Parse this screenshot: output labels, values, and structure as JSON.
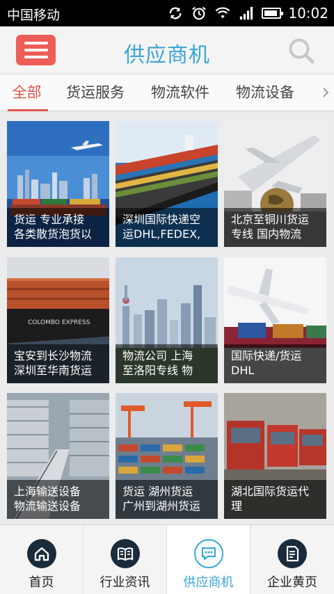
{
  "status_bar": {
    "carrier": "中国移动",
    "time": "10:02",
    "icons": [
      "sync-icon",
      "alarm-icon",
      "wifi-icon",
      "signal-icon",
      "battery-icon"
    ],
    "battery_level": 0.9
  },
  "header": {
    "title": "供应商机",
    "menu_icon": "hamburger-menu-icon",
    "search_icon": "search-icon"
  },
  "tabs": [
    {
      "label": "全部",
      "active": true
    },
    {
      "label": "货运服务",
      "active": false
    },
    {
      "label": "物流软件",
      "active": false
    },
    {
      "label": "物流设备",
      "active": false
    }
  ],
  "tabs_more_icon": "chevron-right-icon",
  "items": [
    {
      "line1": "货运 专业承接",
      "line2": "各类散货泡货以",
      "image": "city-harbor-airplane"
    },
    {
      "line1": "深圳国际快递空",
      "line2": "运DHL,FEDEX,",
      "image": "container-ship"
    },
    {
      "line1": "北京至铜川货运",
      "line2": "专线 国内物流",
      "image": "airplane-globe"
    },
    {
      "line1": "宝安到长沙物流",
      "line2": "深圳至华南货运",
      "image": "colombo-express-ship"
    },
    {
      "line1": "物流公司 上海",
      "line2": "至洛阳专线 物",
      "image": "shanghai-skyline"
    },
    {
      "line1": "国际快递/货运",
      "line2": "DHL",
      "image": "airplane-trucks"
    },
    {
      "line1": "上海输送设备",
      "line2": "物流输送设备",
      "image": "warehouse-conveyor"
    },
    {
      "line1": "货运 湖州货运",
      "line2": "广州到湖州货运",
      "image": "container-port-cranes"
    },
    {
      "line1": "湖北国际货运代",
      "line2": "理",
      "image": "red-trucks"
    }
  ],
  "colors": {
    "accent_blue": "#3aa6d6",
    "accent_red": "#ec5d57",
    "nav_icon_dark": "#1a2b3c"
  },
  "bottom_nav": [
    {
      "label": "首页",
      "icon": "home-icon",
      "active": false
    },
    {
      "label": "行业资讯",
      "icon": "book-icon",
      "active": false
    },
    {
      "label": "供应商机",
      "icon": "chat-bubble-icon",
      "active": true
    },
    {
      "label": "企业黄页",
      "icon": "document-icon",
      "active": false
    }
  ]
}
